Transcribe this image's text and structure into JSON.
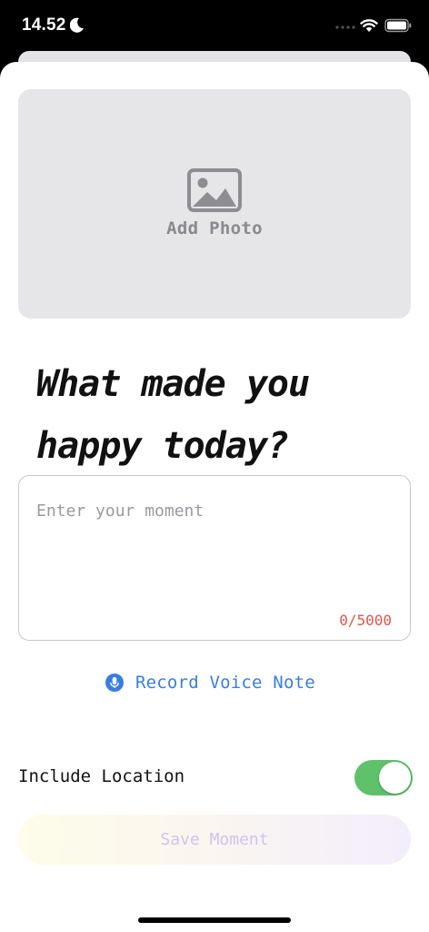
{
  "status_bar": {
    "time": "14.52",
    "icons": [
      "moon-icon",
      "cellular-dots-icon",
      "wifi-icon",
      "battery-icon"
    ]
  },
  "photo": {
    "icon": "image-icon",
    "label": "Add Photo"
  },
  "prompt": {
    "title": "What made you happy today?"
  },
  "moment_input": {
    "placeholder": "Enter your moment",
    "value": "",
    "char_count": "0/5000"
  },
  "voice_note": {
    "icon": "microphone-icon",
    "label": "Record Voice Note"
  },
  "location": {
    "label": "Include Location",
    "enabled": true
  },
  "save": {
    "label": "Save Moment"
  },
  "colors": {
    "accent_blue": "#3a7de0",
    "toggle_green": "#5fc26a",
    "count_red": "#e0554b",
    "save_text": "#cfc3ee"
  }
}
